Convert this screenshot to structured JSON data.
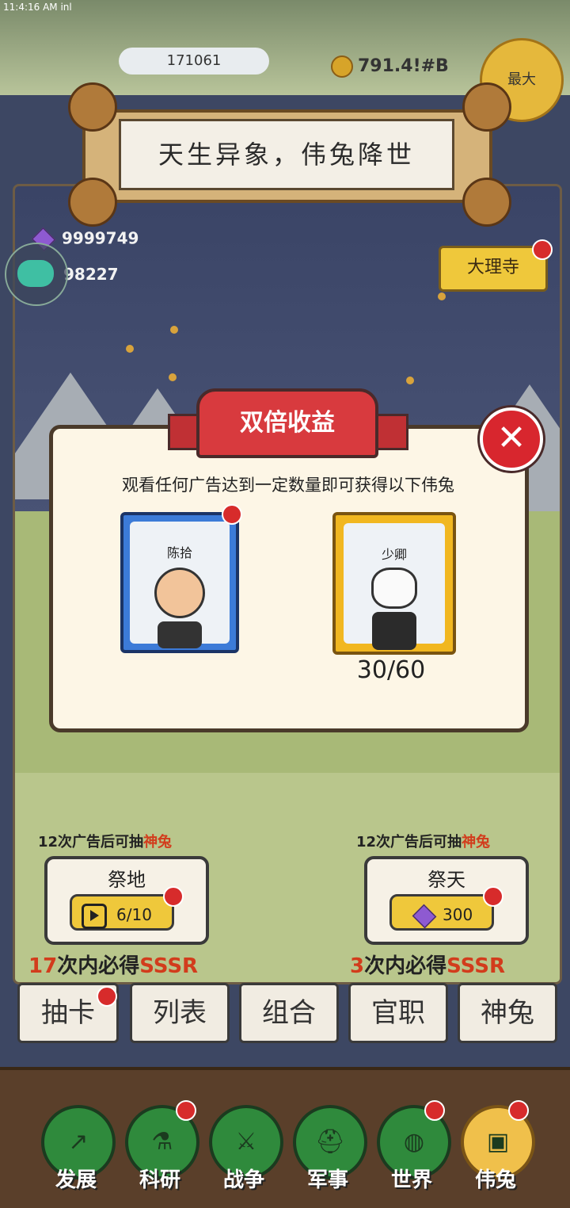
{
  "status_bar": {
    "time": "11:4:16 AM inl"
  },
  "top": {
    "stone_count": "171061",
    "coins": "791.4!#B",
    "max_label": "最大"
  },
  "banner": {
    "title": "天生异象，伟兔降世"
  },
  "resources": {
    "gems": "9999749",
    "second": "98227"
  },
  "dali_button": {
    "label": "大理寺"
  },
  "dialog": {
    "ribbon": "双倍收益",
    "close_glyph": "✕",
    "message": "观看任何广告达到一定数量即可获得以下伟兔",
    "card_left": {
      "name": "陈拾"
    },
    "card_right": {
      "name": "少卿",
      "progress": "30/60"
    }
  },
  "draw_left": {
    "hint_prefix": "12次广告后可抽",
    "hint_highlight": "神兔",
    "title": "祭地",
    "progress": "6/10",
    "guarantee_num": "17",
    "guarantee_text": "次内必得",
    "guarantee_rank": "SSSR"
  },
  "draw_right": {
    "hint_prefix": "12次广告后可抽",
    "hint_highlight": "神兔",
    "title": "祭天",
    "cost": "300",
    "guarantee_num": "3",
    "guarantee_text": "次内必得",
    "guarantee_rank": "SSSR"
  },
  "tabs": [
    "抽卡",
    "列表",
    "组合",
    "官职",
    "神兔"
  ],
  "nav": [
    {
      "label": "发展",
      "icon": "arrow-up-icon"
    },
    {
      "label": "科研",
      "icon": "flask-icon"
    },
    {
      "label": "战争",
      "icon": "crossed-swords-icon"
    },
    {
      "label": "军事",
      "icon": "helmet-icon"
    },
    {
      "label": "世界",
      "icon": "globe-icon"
    },
    {
      "label": "伟兔",
      "icon": "rabbit-card-icon"
    }
  ],
  "colors": {
    "accent_red": "#d23c1c",
    "gold": "#efc83b",
    "dialog_bg": "#fdf6e6"
  }
}
